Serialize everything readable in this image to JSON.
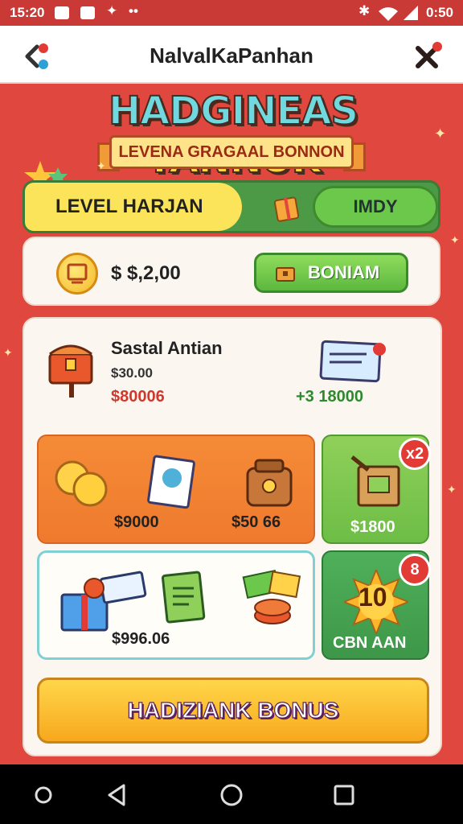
{
  "status_bar": {
    "time": "15:20",
    "right_time": "0:50"
  },
  "top_bar": {
    "title": "NalvalKaPanhan"
  },
  "hero": {
    "title_part1": "HADGINEAS",
    "title_part2": "YANNUK",
    "ribbon": "LEVENA GRAGAAL BONNON"
  },
  "tabs": {
    "level_label": "LEVEL HARJAN",
    "button_label": "IMDY"
  },
  "balance": {
    "amount": "$ $,2,00",
    "button_label": "BONIAM"
  },
  "offer": {
    "title": "Sastal Antian",
    "price_small": "$30.00",
    "price_red": "$80006",
    "price_right": "+3 18000"
  },
  "grid": {
    "orange_price_a": "$9000",
    "orange_price_b": "$50 66",
    "green_price": "$1800",
    "green_badge": "x2",
    "white_price": "$996.06",
    "dark_number": "10",
    "dark_badge": "8",
    "dark_label": "CBN AAN"
  },
  "cta": {
    "label": "HADIZIANK BONUS"
  },
  "colors": {
    "background": "#e0473f",
    "accent_green": "#6cc84a",
    "accent_orange": "#f58b37",
    "accent_yellow": "#fbe35a"
  }
}
